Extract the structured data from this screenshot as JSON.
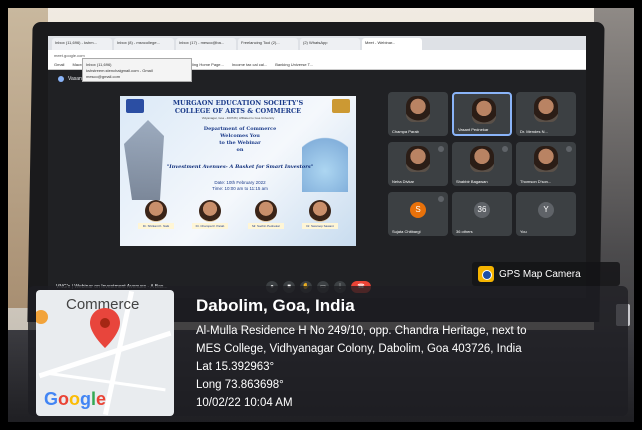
{
  "browser": {
    "tabs": [
      "Inbox (11,696) - kshm...",
      "Inbox (8) - msncollege...",
      "Inbox (17) - mesco@ba...",
      "Freelancing Tool (2)...",
      "(2) WhatsApp",
      "Meet - Webinar..."
    ],
    "address": "meet.google.com",
    "bookmarks": [
      "Gmail",
      "Macro Environment...",
      "DHE GOA",
      "MS Application S...",
      "e-filing Home Page...",
      "Income tax cal cal...",
      "Banking Universe T..."
    ],
    "tooltip_lines": [
      "Inbox (11,696)",
      "kshstreem.stenchaigmail.com - Gmail",
      "mesco@gmail.com"
    ]
  },
  "meet": {
    "presenting_text": "Vasant Pednekar is presenting",
    "title": "VNG's | Webinar on Investment Avenues - A Bas...",
    "participants": [
      {
        "name": "Champa Parab",
        "type": "video"
      },
      {
        "name": "Vasant Pednekar",
        "type": "video",
        "highlight": true
      },
      {
        "name": "Dr. Mendes N...",
        "type": "video"
      },
      {
        "name": "Neha Divkar",
        "type": "video"
      },
      {
        "name": "Shabbir Bagawan",
        "type": "video"
      },
      {
        "name": "Thomson D'son...",
        "type": "video"
      },
      {
        "name": "Sujata Chitbargi",
        "type": "avatar",
        "initial": "S"
      },
      {
        "name": "36 others",
        "type": "avatar",
        "initial": "36"
      },
      {
        "name": "You",
        "type": "avatar",
        "initial": "Y"
      }
    ],
    "controls": [
      "mic-icon",
      "camera-icon",
      "raise-hand-icon",
      "present-icon",
      "more-icon",
      "end-call-icon"
    ]
  },
  "slide": {
    "org": "MURGAON EDUCATION SOCIETY'S",
    "college": "COLLEGE OF ARTS & COMMERCE",
    "small": "Vidyanagar, Goa - 403726 | Affiliated to Goa University",
    "dept": [
      "Department of Commerce",
      "Welcomes You",
      "to the Webinar",
      "on"
    ],
    "topic": "\"Investment Avenues- A Basket for Smart Investors\"",
    "date": "Date: 10th February 2022",
    "time": "Time: 10:00 am to 11:15 am",
    "speakers": [
      "Dr. Shrikant K. Naik",
      "Dr. Champa R. Parab",
      "Mr. Sachin Pednekar",
      "Dr. Swaroop Sawant"
    ]
  },
  "gps": {
    "app": "GPS Map Camera",
    "map_label": "Commerce",
    "map_brand": "Google",
    "city": "Dabolim, Goa, India",
    "address_lines": [
      "Al-Mulla Residence H No 249/10, opp. Chandra Heritage, next to",
      "MES College, Vidhyanagar Colony, Dabolim, Goa 403726, India",
      "Lat 15.392963°",
      "Long 73.863698°",
      "10/02/22 10:04 AM"
    ]
  }
}
